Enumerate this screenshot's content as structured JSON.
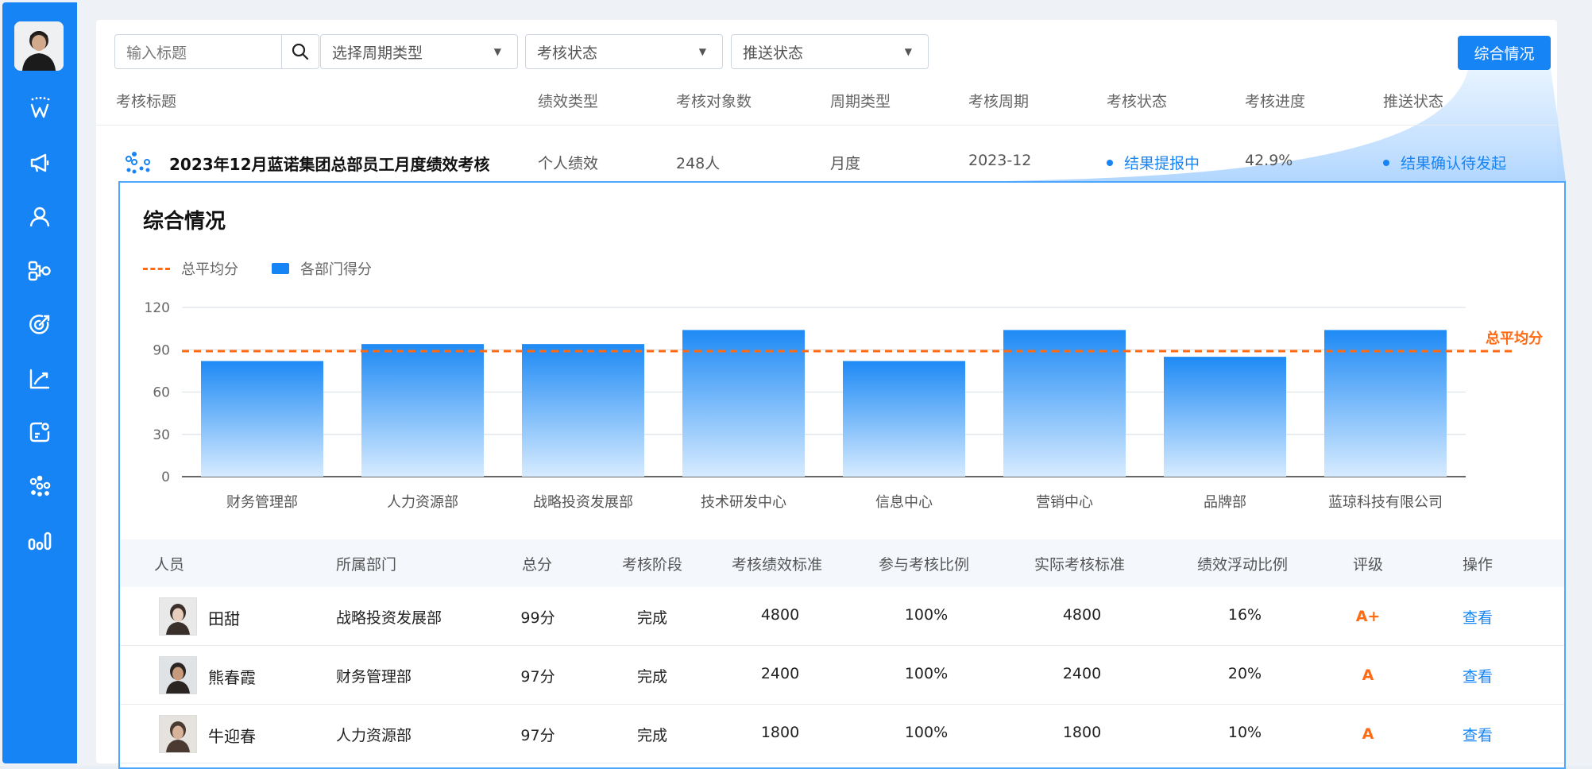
{
  "filters": {
    "search_placeholder": "输入标题",
    "cycle_type": "选择周期类型",
    "assess_status": "考核状态",
    "push_status": "推送状态",
    "summary_button": "综合情况"
  },
  "list": {
    "headers": [
      "考核标题",
      "绩效类型",
      "考核对象数",
      "周期类型",
      "考核周期",
      "考核状态",
      "考核进度",
      "推送状态"
    ],
    "row": {
      "title": "2023年12月蓝诺集团总部员工月度绩效考核",
      "type": "个人绩效",
      "count": "248人",
      "cycle_type": "月度",
      "cycle": "2023-12",
      "status": "结果提报中",
      "progress": "42.9%",
      "push_status": "结果确认待发起"
    }
  },
  "panel": {
    "title": "综合情况",
    "legend_avg": "总平均分",
    "legend_dept": "各部门得分"
  },
  "chart_data": {
    "type": "bar",
    "categories": [
      "财务管理部",
      "人力资源部",
      "战略投资发展部",
      "技术研发中心",
      "信息中心",
      "营销中心",
      "品牌部",
      "蓝琼科技有限公司"
    ],
    "series": [
      {
        "name": "各部门得分",
        "values": [
          82,
          94,
          94,
          104,
          82,
          104,
          85,
          104
        ]
      }
    ],
    "average": 89,
    "average_label": "总平均分",
    "yticks": [
      0,
      30,
      60,
      90,
      120
    ],
    "ylim": [
      0,
      120
    ],
    "grid": true,
    "legend": "top-left",
    "colors": {
      "bar": "#1784f5",
      "average": "#ff6a13"
    }
  },
  "table": {
    "headers": [
      "人员",
      "所属部门",
      "总分",
      "考核阶段",
      "考核绩效标准",
      "参与考核比例",
      "实际考核标准",
      "绩效浮动比例",
      "评级",
      "操作"
    ],
    "rows": [
      {
        "name": "田甜",
        "dept": "战略投资发展部",
        "score": "99分",
        "stage": "完成",
        "standard": "4800",
        "ratio": "100%",
        "actual": "4800",
        "float": "16%",
        "grade": "A+",
        "action": "查看"
      },
      {
        "name": "熊春霞",
        "dept": "财务管理部",
        "score": "97分",
        "stage": "完成",
        "standard": "2400",
        "ratio": "100%",
        "actual": "2400",
        "float": "20%",
        "grade": "A",
        "action": "查看"
      },
      {
        "name": "牛迎春",
        "dept": "人力资源部",
        "score": "97分",
        "stage": "完成",
        "standard": "1800",
        "ratio": "100%",
        "actual": "1800",
        "float": "10%",
        "grade": "A",
        "action": "查看"
      }
    ]
  },
  "colors": {
    "primary": "#1784f5",
    "accent": "#ff6a13"
  }
}
